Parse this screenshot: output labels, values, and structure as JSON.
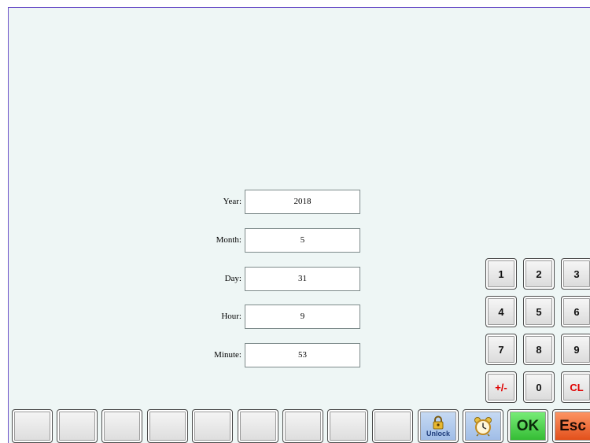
{
  "form": {
    "year_label": "Year:",
    "year_value": "2018",
    "month_label": "Month:",
    "month_value": "5",
    "day_label": "Day:",
    "day_value": "31",
    "hour_label": "Hour:",
    "hour_value": "9",
    "minute_label": "Minute:",
    "minute_value": "53"
  },
  "keypad": {
    "k1": "1",
    "k2": "2",
    "k3": "3",
    "k4": "4",
    "k5": "5",
    "k6": "6",
    "k7": "7",
    "k8": "8",
    "k9": "9",
    "sign": "+/-",
    "k0": "0",
    "clear": "CL"
  },
  "toolbar": {
    "unlock_label": "Unlock",
    "ok_label": "OK",
    "esc_label": "Esc",
    "unlock_icon": "padlock-icon",
    "clock_icon": "alarm-clock-icon"
  },
  "colors": {
    "background": "#eef6f5",
    "frame_border": "#6b50c8",
    "clear_text": "#e00000",
    "ok_green": "#2fb82f",
    "esc_orange": "#e04a15"
  }
}
